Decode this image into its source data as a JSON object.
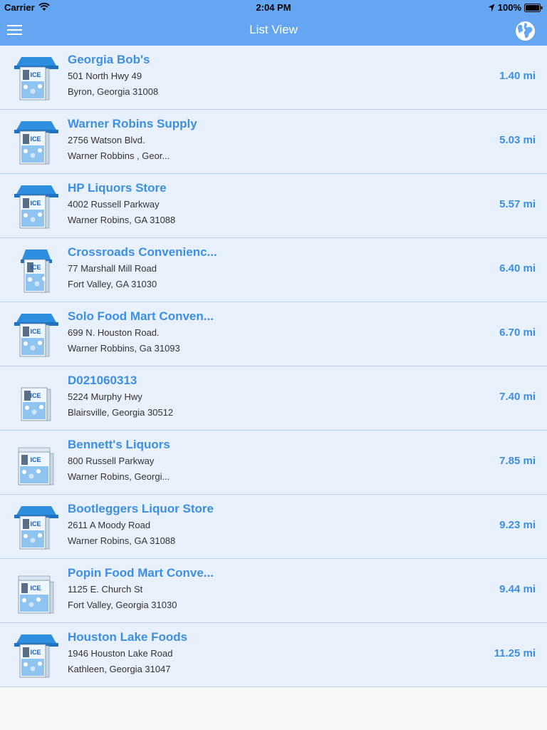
{
  "status_bar": {
    "carrier": "Carrier",
    "time": "2:04 PM",
    "battery": "100%"
  },
  "nav": {
    "title": "List View",
    "menu_icon": "hamburger-menu-icon",
    "globe_icon": "globe-icon"
  },
  "colors": {
    "header": "#65a6f2",
    "row_bg": "#e8f1fb",
    "accent": "#3d8ee6"
  },
  "locations": [
    {
      "name": "Georgia Bob's",
      "address1": "501 North Hwy 49",
      "address2": "Byron, Georgia 31008",
      "distance": "1.40 mi",
      "machine": "canopy"
    },
    {
      "name": "Warner Robins Supply",
      "address1": "2756 Watson Blvd.",
      "address2": "Warner Robbins , Geor...",
      "distance": "5.03 mi",
      "machine": "canopy"
    },
    {
      "name": "HP Liquors Store",
      "address1": "4002 Russell Parkway",
      "address2": "Warner Robins, GA 31088",
      "distance": "5.57 mi",
      "machine": "canopy"
    },
    {
      "name": "Crossroads Convenienc...",
      "address1": "77 Marshall Mill Road",
      "address2": "Fort Valley, GA 31030",
      "distance": "6.40 mi",
      "machine": "small-canopy"
    },
    {
      "name": "Solo Food Mart Conven...",
      "address1": "699 N. Houston Road.",
      "address2": "Warner Robbins, Ga 31093",
      "distance": "6.70 mi",
      "machine": "canopy"
    },
    {
      "name": "D021060313",
      "address1": "5224 Murphy Hwy",
      "address2": "Blairsville, Georgia 30512",
      "distance": "7.40 mi",
      "machine": "plain"
    },
    {
      "name": "Bennett's Liquors",
      "address1": "800 Russell Parkway",
      "address2": "Warner Robins, Georgi...",
      "distance": "7.85 mi",
      "machine": "plain-wide"
    },
    {
      "name": "Bootleggers Liquor Store",
      "address1": "2611 A Moody Road",
      "address2": "Warner Robins, GA 31088",
      "distance": "9.23 mi",
      "machine": "canopy"
    },
    {
      "name": "Popin Food Mart Conve...",
      "address1": "1125 E. Church St",
      "address2": "Fort Valley, Georgia 31030",
      "distance": "9.44 mi",
      "machine": "plain-wide"
    },
    {
      "name": "Houston Lake Foods",
      "address1": "1946 Houston Lake Road",
      "address2": "Kathleen, Georgia 31047",
      "distance": "11.25 mi",
      "machine": "canopy"
    }
  ]
}
